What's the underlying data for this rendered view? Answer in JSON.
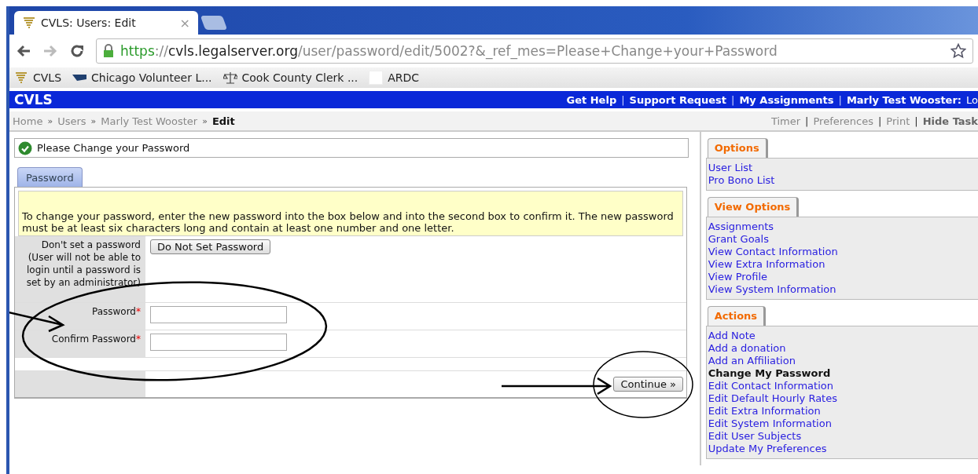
{
  "browser": {
    "tab_title": "CVLS: Users: Edit",
    "tab_close": "×",
    "url_parts": [
      {
        "kind": "scheme",
        "text": "https"
      },
      {
        "kind": "path",
        "text": "://"
      },
      {
        "kind": "host",
        "text": "cvls.legalserver.org"
      },
      {
        "kind": "path",
        "text": "/user/password/edit/5002?&_ref_mes=Please+Change+your+Password"
      }
    ],
    "bookmarks": [
      {
        "kind": "tornado",
        "label": "CVLS"
      },
      {
        "kind": "flag",
        "label": "Chicago Volunteer L..."
      },
      {
        "kind": "scales",
        "label": "Cook County Clerk ..."
      },
      {
        "kind": "blank",
        "label": "ARDC"
      }
    ]
  },
  "header": {
    "brand": "CVLS",
    "links": [
      "Get Help",
      "Support Request",
      "My Assignments",
      "Marly Test Wooster:"
    ],
    "link_cut": "Lo"
  },
  "breadcrumbs": [
    {
      "label": "Home",
      "current": false
    },
    {
      "label": "Users",
      "current": false
    },
    {
      "label": "Marly Test Wooster",
      "current": false
    },
    {
      "label": "Edit",
      "current": true
    }
  ],
  "breadcrumb_separator": "»",
  "link_separator": "|",
  "page_tools": [
    {
      "label": "Timer",
      "bold": false
    },
    {
      "label": "Preferences",
      "bold": false
    },
    {
      "label": "Print",
      "bold": false
    },
    {
      "label": "Hide Task",
      "bold": true
    }
  ],
  "message": "Please Change your Password",
  "tabs": [
    {
      "label": "Password",
      "selected": true
    }
  ],
  "notice": "To change your password, enter the new password into the box below and into the second box to confirm it. The new password must be at least six characters long and contain at least one number and one letter.",
  "form_rows": [
    {
      "kind": "button",
      "label": "Don't set a password (User will not be able to login until a password is set by an administrator)",
      "button": "Do Not Set Password"
    },
    {
      "kind": "input",
      "label": "Password",
      "required": true
    },
    {
      "kind": "input",
      "label": "Confirm Password",
      "required": true
    }
  ],
  "required_mark": "*",
  "submit": "Continue »",
  "sidebar": [
    {
      "title": "Options",
      "items": [
        {
          "label": "User List",
          "current": false
        },
        {
          "label": "Pro Bono List",
          "current": false
        }
      ]
    },
    {
      "title": "View Options",
      "items": [
        {
          "label": "Assignments",
          "current": false
        },
        {
          "label": "Grant Goals",
          "current": false
        },
        {
          "label": "View Contact Information",
          "current": false
        },
        {
          "label": "View Extra Information",
          "current": false
        },
        {
          "label": "View Profile",
          "current": false
        },
        {
          "label": "View System Information",
          "current": false
        }
      ]
    },
    {
      "title": "Actions",
      "items": [
        {
          "label": "Add Note",
          "current": false
        },
        {
          "label": "Add a donation",
          "current": false
        },
        {
          "label": "Add an Affiliation",
          "current": false
        },
        {
          "label": "Change My Password",
          "current": true
        },
        {
          "label": "Edit Contact Information",
          "current": false
        },
        {
          "label": "Edit Default Hourly Rates",
          "current": false
        },
        {
          "label": "Edit Extra Information",
          "current": false
        },
        {
          "label": "Edit System Information",
          "current": false
        },
        {
          "label": "Edit User Subjects",
          "current": false
        },
        {
          "label": "Update My Preferences",
          "current": false
        }
      ]
    }
  ]
}
